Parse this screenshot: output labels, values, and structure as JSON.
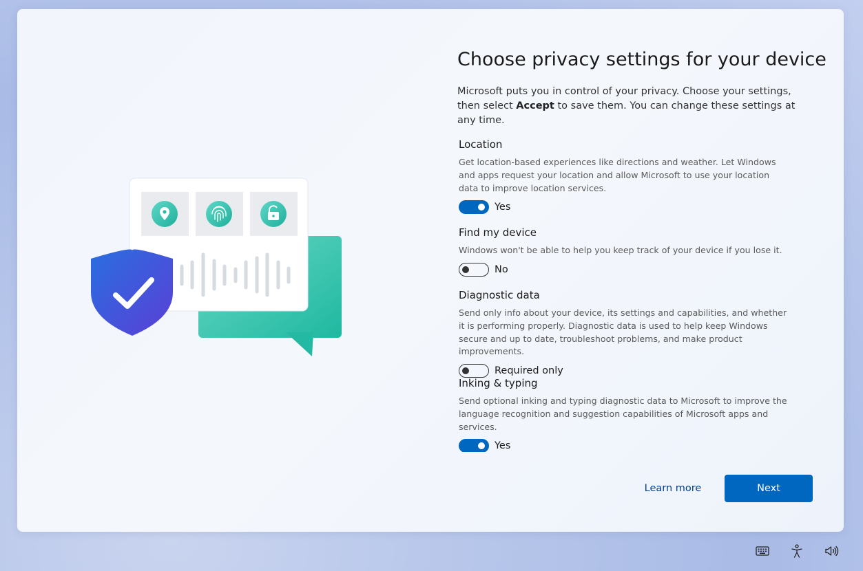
{
  "page": {
    "title": "Choose privacy settings for your device",
    "subtitle_pre": "Microsoft puts you in control of your privacy. Choose your settings, then select ",
    "subtitle_bold": "Accept",
    "subtitle_post": " to save them. You can change these settings at any time."
  },
  "settings": [
    {
      "title": "Location",
      "description": "Get location-based experiences like directions and weather. Let Windows and apps request your location and allow Microsoft to use your location data to improve location services.",
      "toggle_state": "on",
      "toggle_label": "Yes"
    },
    {
      "title": "Find my device",
      "description": "Windows won't be able to help you keep track of your device if you lose it.",
      "toggle_state": "off",
      "toggle_label": "No"
    },
    {
      "title": "Diagnostic data",
      "description": "Send only info about your device, its settings and capabilities, and whether it is performing properly. Diagnostic data is used to help keep Windows secure and up to date, troubleshoot problems, and make product improvements.",
      "toggle_state": "off",
      "toggle_label": "Required only"
    },
    {
      "title": "Inking & typing",
      "description": "Send optional inking and typing diagnostic data to Microsoft to improve the language recognition and suggestion capabilities of Microsoft apps and services.",
      "toggle_state": "on",
      "toggle_label": "Yes"
    }
  ],
  "footer": {
    "learn_more": "Learn more",
    "next": "Next"
  },
  "taskbar": {
    "icons": [
      "keyboard-icon",
      "accessibility-icon",
      "volume-icon"
    ]
  },
  "colors": {
    "accent": "#0067c0",
    "link": "#003e92"
  }
}
